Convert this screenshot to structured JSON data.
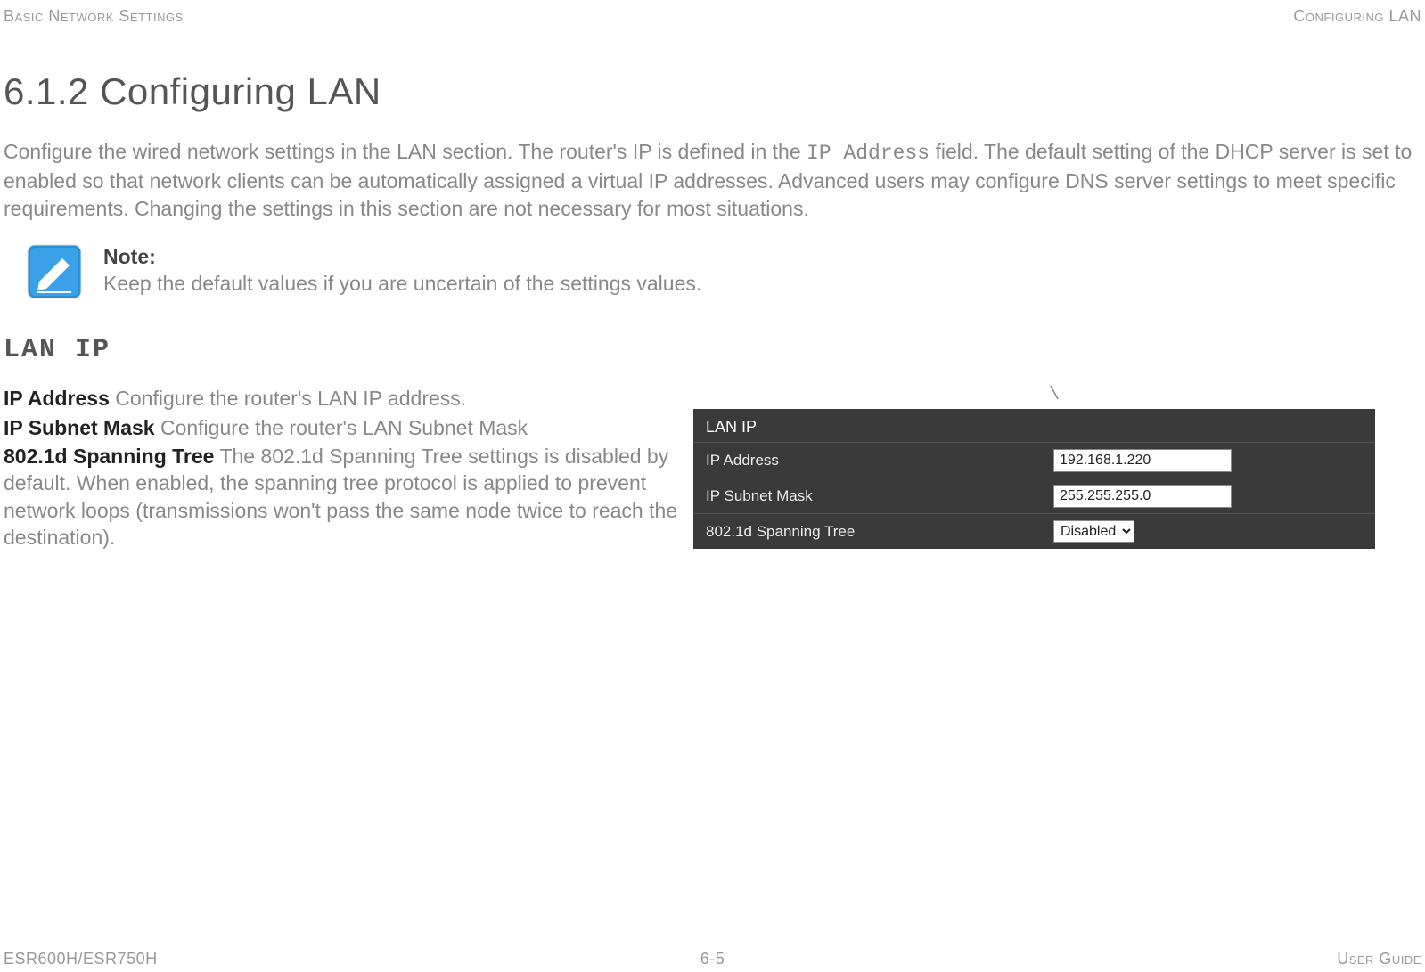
{
  "header": {
    "left": "Basic Network Settings",
    "right": "Configuring LAN"
  },
  "heading": "6.1.2 Configuring LAN",
  "intro": {
    "part1": "Configure the wired network settings in the LAN section. The router's IP is defined in the ",
    "code": "IP Address",
    "part2": " field. The default setting of the DHCP server is set to enabled so that network clients can be automatically assigned a virtual IP addresses. Advanced users may configure DNS server settings to meet specific requirements. Changing the settings in this section are not necessary for most situations."
  },
  "note": {
    "label": "Note:",
    "text": "Keep the default values if you are uncertain of the settings values."
  },
  "section_heading": "LAN IP",
  "definitions": {
    "ip_address": {
      "term": "IP Address",
      "desc": "  Configure the router's LAN IP address."
    },
    "subnet": {
      "term": "IP Subnet Mask",
      "desc": "  Configure the router's LAN Subnet Mask"
    },
    "spanning": {
      "term": "802.1d Spanning Tree",
      "desc": "  The 802.1d Spanning Tree settings is disabled by default. When enabled, the spanning tree protocol is applied to prevent network loops (transmissions won't pass the same node twice to reach the destination)."
    }
  },
  "stray": "\\",
  "panel": {
    "title": "LAN IP",
    "rows": {
      "ip": {
        "label": "IP Address",
        "value": "192.168.1.220"
      },
      "mask": {
        "label": "IP Subnet Mask",
        "value": "255.255.255.0"
      },
      "stp": {
        "label": "802.1d Spanning Tree",
        "value": "Disabled"
      }
    }
  },
  "footer": {
    "left": "ESR600H/ESR750H",
    "center": "6-5",
    "right": "User Guide"
  }
}
